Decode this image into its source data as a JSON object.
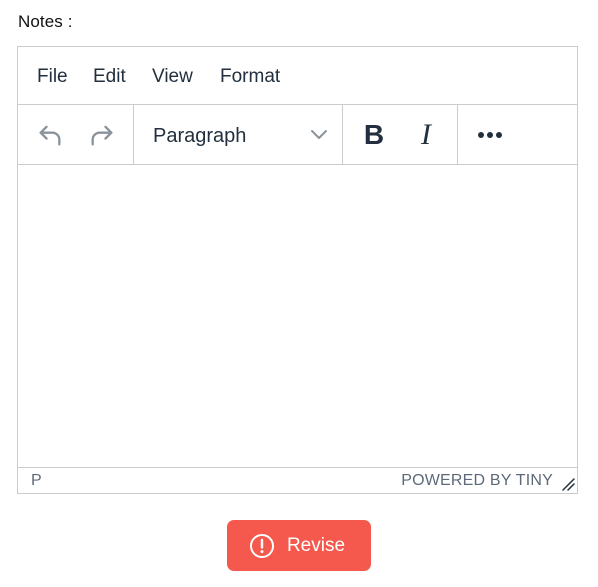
{
  "form": {
    "notes_label": "Notes :"
  },
  "editor": {
    "menubar": {
      "file": "File",
      "edit": "Edit",
      "view": "View",
      "format": "Format"
    },
    "toolbar": {
      "undo_icon": "undo-icon",
      "redo_icon": "redo-icon",
      "block_format": "Paragraph",
      "bold_label": "B",
      "italic_label": "I",
      "more_icon": "more-horizontal-icon"
    },
    "content": "",
    "statusbar": {
      "path": "P",
      "branding": "POWERED BY TINY"
    }
  },
  "actions": {
    "revise_label": "Revise",
    "revise_icon": "exclamation-circle-icon",
    "revise_color": "#f5594e"
  }
}
